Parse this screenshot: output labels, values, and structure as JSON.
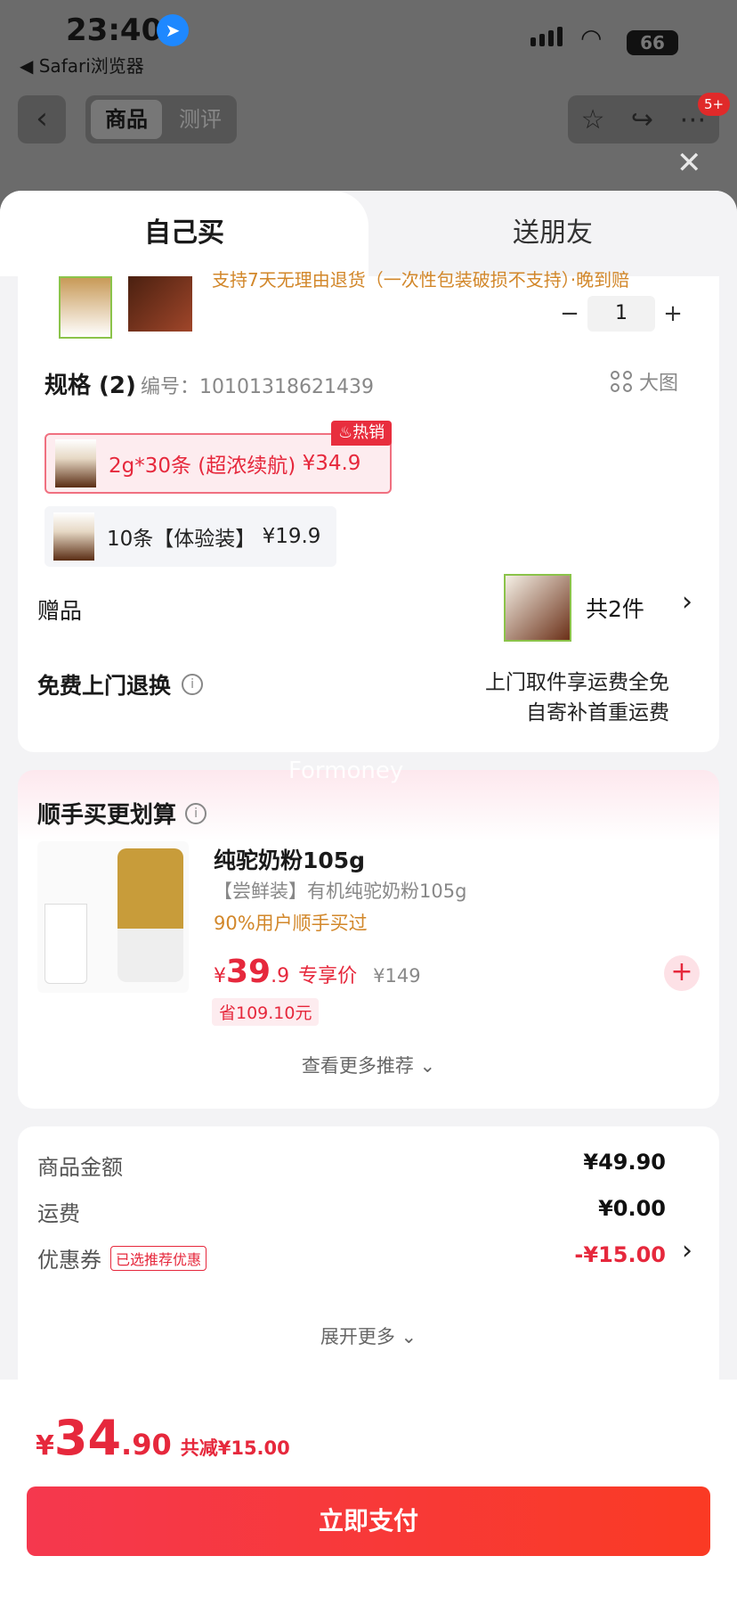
{
  "status_bar": {
    "time": "23:40",
    "back_app": "◀ Safari浏览器",
    "battery": "66"
  },
  "nav": {
    "tab_product": "商品",
    "tab_review": "测评",
    "badge": "5+"
  },
  "sheet_tabs": {
    "self_buy": "自己买",
    "gift_friend": "送朋友"
  },
  "product": {
    "cut_notice": "支持7天无理由退货（一次性包装破损不支持）·晚到赔",
    "quantity": "1",
    "spec_title": "规格 (2)",
    "spec_code": "编号：10101318621439",
    "big_image": "大图",
    "hot_badge": "热销",
    "options": [
      {
        "label": "2g*30条 (超浓续航)",
        "price": "¥34.9",
        "selected": true
      },
      {
        "label": "10条【体验装】",
        "price": "¥19.9",
        "selected": false
      }
    ]
  },
  "gift": {
    "label": "赠品",
    "count": "共2件"
  },
  "return": {
    "label": "免费上门退换",
    "line1": "上门取件享运费全免",
    "line2": "自寄补首重运费"
  },
  "recommend": {
    "title": "顺手买更划算",
    "watermark": "Formoney",
    "name": "纯驼奶粉105g",
    "subtitle": "【尝鲜装】有机纯驼奶粉105g",
    "buy_stat": "90%用户顺手买过",
    "price_cur": "¥",
    "price_int": "39",
    "price_dec": ".9",
    "price_tag": "专享价",
    "orig_price": "¥149",
    "save": "省109.10元",
    "more": "查看更多推荐 ⌄"
  },
  "summary": {
    "goods_label": "商品金额",
    "goods_value": "¥49.90",
    "ship_label": "运费",
    "ship_value": "¥0.00",
    "coupon_label": "优惠券",
    "coupon_tag": "已选推荐优惠",
    "coupon_value": "-¥15.00",
    "expand": "展开更多 ⌄"
  },
  "footer": {
    "cur": "¥",
    "int": "34",
    "dec": ".90",
    "save": "共减¥15.00",
    "pay": "立即支付"
  },
  "colors": {
    "accent": "#e6283c",
    "orange": "#d2872a"
  }
}
